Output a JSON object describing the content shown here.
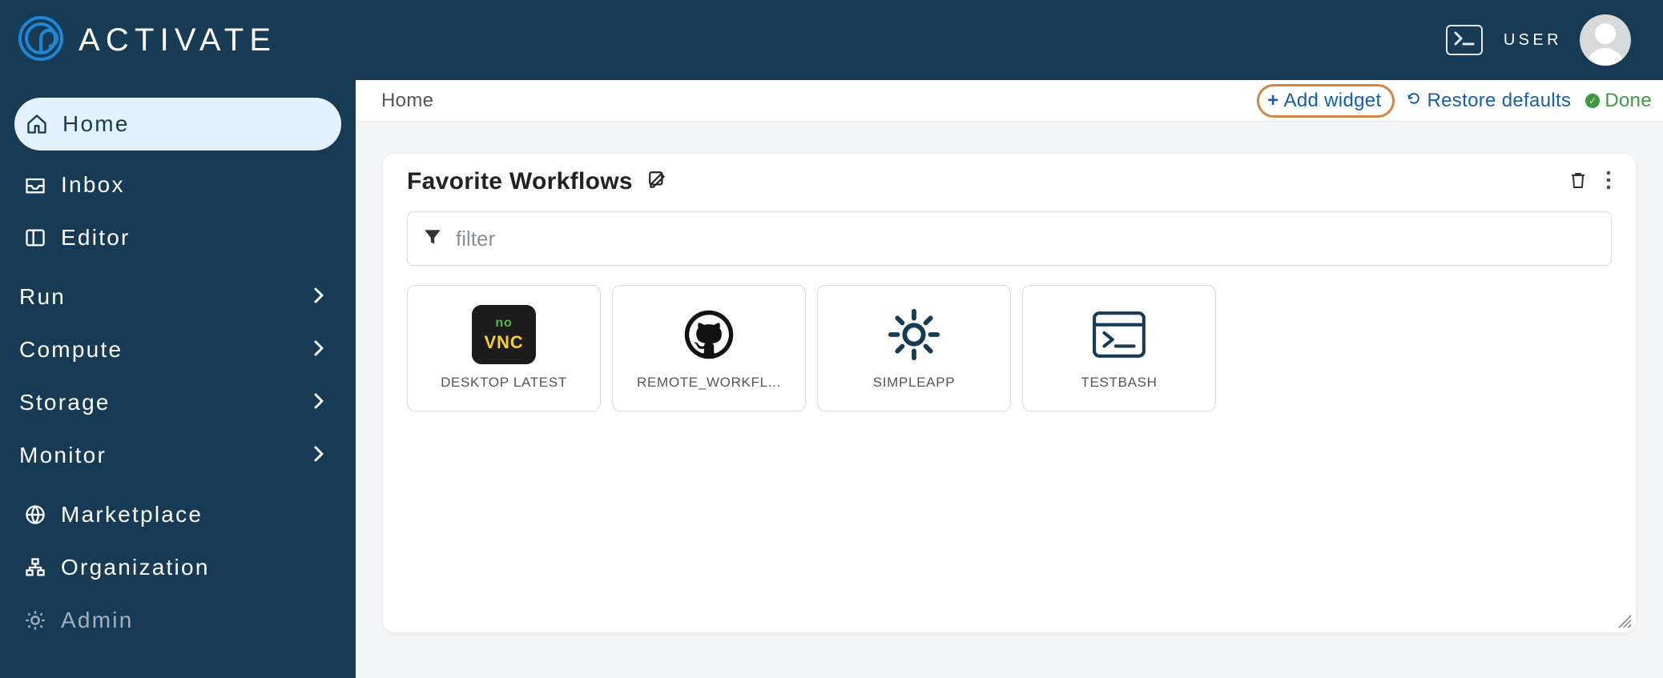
{
  "brand": {
    "name": "ACTIVATE"
  },
  "header": {
    "user_label": "USER"
  },
  "sidebar": {
    "items": [
      {
        "label": "Home"
      },
      {
        "label": "Inbox"
      },
      {
        "label": "Editor"
      }
    ],
    "groups": [
      {
        "label": "Run"
      },
      {
        "label": "Compute"
      },
      {
        "label": "Storage"
      },
      {
        "label": "Monitor"
      }
    ],
    "bottom": [
      {
        "label": "Marketplace"
      },
      {
        "label": "Organization"
      },
      {
        "label": "Admin"
      }
    ]
  },
  "breadcrumb": {
    "title": "Home",
    "add_widget": "Add widget",
    "restore_defaults": "Restore defaults",
    "done": "Done"
  },
  "widget": {
    "title": "Favorite Workflows",
    "filter_placeholder": "filter",
    "tiles": [
      {
        "label": "DESKTOP LATEST"
      },
      {
        "label": "REMOTE_WORKFL..."
      },
      {
        "label": "SIMPLEAPP"
      },
      {
        "label": "TESTBASH"
      }
    ]
  }
}
